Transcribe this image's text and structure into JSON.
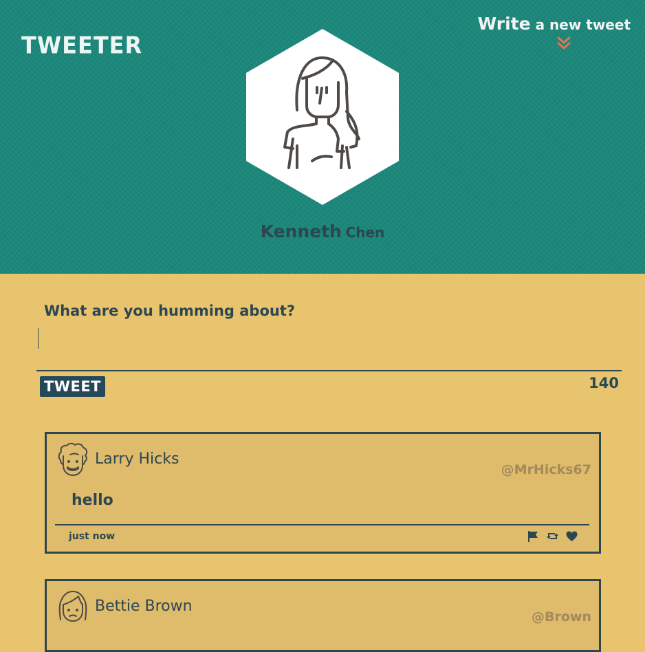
{
  "app": {
    "logo_text": "TWEETER"
  },
  "header": {
    "write_new_big": "Write",
    "write_new_small": " a new tweet",
    "profile": {
      "first_name": "Kenneth",
      "last_name": "Chen",
      "avatar_icon": "woman-avatar-icon"
    }
  },
  "compose": {
    "prompt": "What are you humming about?",
    "value": "",
    "tweet_button_label": "TWEET",
    "char_count": "140"
  },
  "tweets": [
    {
      "name": "Larry Hicks",
      "handle": "@MrHicks67",
      "text": "hello",
      "time": "just now",
      "avatar_icon": "curly-hair-man-avatar-icon",
      "actions": [
        "flag-icon",
        "retweet-icon",
        "heart-icon"
      ]
    },
    {
      "name": "Bettie Brown",
      "handle": "@Brown",
      "avatar_icon": "woman-avatar-icon"
    }
  ],
  "colors": {
    "header_bg": "#1b877a",
    "page_bg": "#e9c46f",
    "card_bg": "#dfbb6c",
    "accent": "#e37456",
    "dark": "#2d4650"
  }
}
